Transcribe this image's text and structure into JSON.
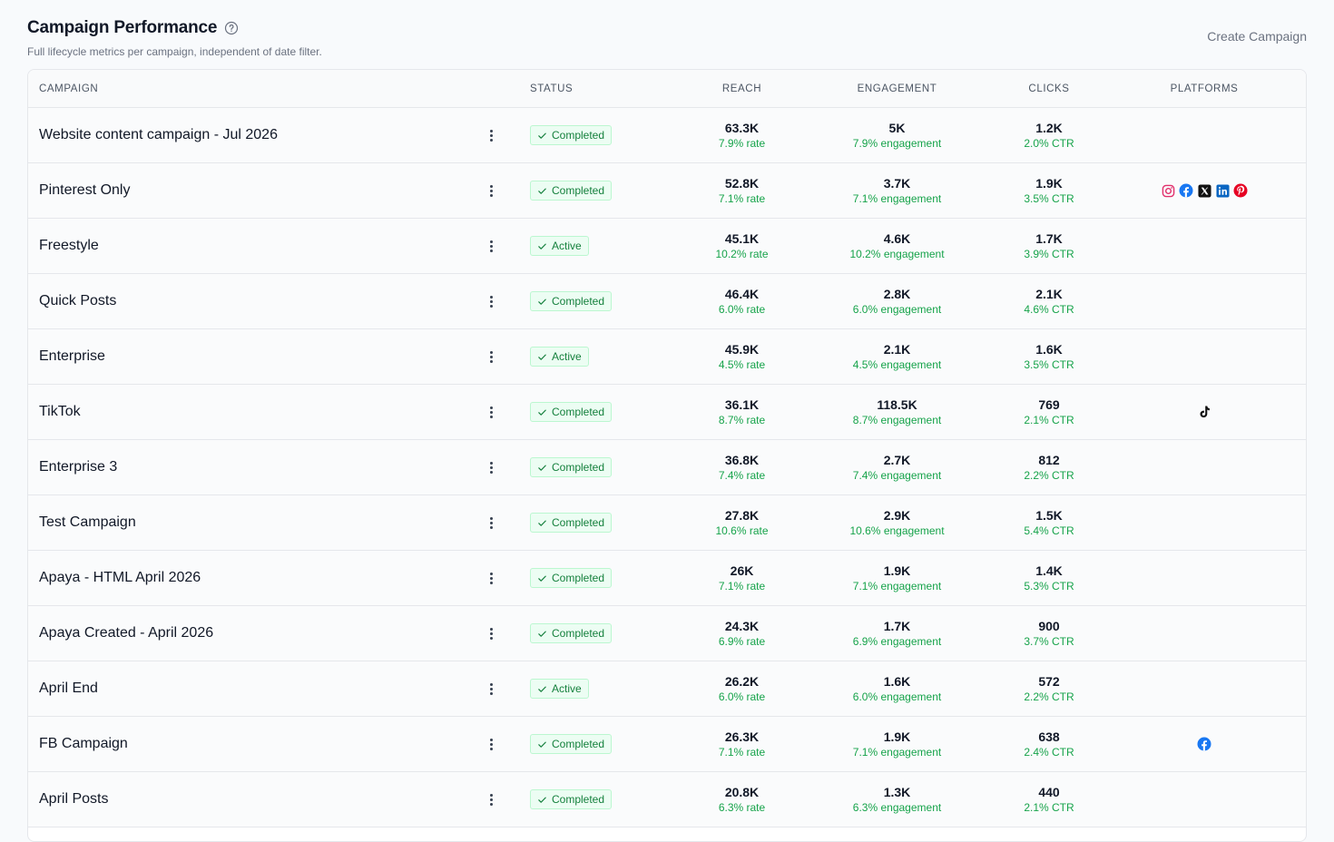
{
  "header": {
    "title": "Campaign Performance",
    "subtitle": "Full lifecycle metrics per campaign, independent of date filter.",
    "create_label": "Create Campaign"
  },
  "columns": {
    "campaign": "CAMPAIGN",
    "status": "STATUS",
    "reach": "REACH",
    "engagement": "ENGAGEMENT",
    "clicks": "CLICKS",
    "platforms": "PLATFORMS"
  },
  "colors": {
    "status_green": "#15803d",
    "badge_bg": "#ecfdf3",
    "metric_green": "#16a34a",
    "instagram": "#e1306c",
    "facebook": "#1877f2",
    "linkedin": "#0a66c2",
    "pinterest": "#e60023"
  },
  "rows": [
    {
      "name": "Website content campaign - Jul 2026",
      "status": "Completed",
      "reach": "63.3K",
      "reach_rate": "7.9% rate",
      "engagement": "5K",
      "engagement_rate": "7.9% engagement",
      "clicks": "1.2K",
      "ctr": "2.0% CTR",
      "platforms": []
    },
    {
      "name": "Pinterest Only",
      "status": "Completed",
      "reach": "52.8K",
      "reach_rate": "7.1% rate",
      "engagement": "3.7K",
      "engagement_rate": "7.1% engagement",
      "clicks": "1.9K",
      "ctr": "3.5% CTR",
      "platforms": [
        "instagram-icon",
        "facebook-icon",
        "x-icon",
        "linkedin-icon",
        "pinterest-icon"
      ]
    },
    {
      "name": "Freestyle",
      "status": "Active",
      "reach": "45.1K",
      "reach_rate": "10.2% rate",
      "engagement": "4.6K",
      "engagement_rate": "10.2% engagement",
      "clicks": "1.7K",
      "ctr": "3.9% CTR",
      "platforms": []
    },
    {
      "name": "Quick Posts",
      "status": "Completed",
      "reach": "46.4K",
      "reach_rate": "6.0% rate",
      "engagement": "2.8K",
      "engagement_rate": "6.0% engagement",
      "clicks": "2.1K",
      "ctr": "4.6% CTR",
      "platforms": []
    },
    {
      "name": "Enterprise",
      "status": "Active",
      "reach": "45.9K",
      "reach_rate": "4.5% rate",
      "engagement": "2.1K",
      "engagement_rate": "4.5% engagement",
      "clicks": "1.6K",
      "ctr": "3.5% CTR",
      "platforms": []
    },
    {
      "name": "TikTok",
      "status": "Completed",
      "reach": "36.1K",
      "reach_rate": "8.7% rate",
      "engagement": "118.5K",
      "engagement_rate": "8.7% engagement",
      "clicks": "769",
      "ctr": "2.1% CTR",
      "platforms": [
        "tiktok-icon"
      ]
    },
    {
      "name": "Enterprise 3",
      "status": "Completed",
      "reach": "36.8K",
      "reach_rate": "7.4% rate",
      "engagement": "2.7K",
      "engagement_rate": "7.4% engagement",
      "clicks": "812",
      "ctr": "2.2% CTR",
      "platforms": []
    },
    {
      "name": "Test Campaign",
      "status": "Completed",
      "reach": "27.8K",
      "reach_rate": "10.6% rate",
      "engagement": "2.9K",
      "engagement_rate": "10.6% engagement",
      "clicks": "1.5K",
      "ctr": "5.4% CTR",
      "platforms": []
    },
    {
      "name": "Apaya - HTML April 2026",
      "status": "Completed",
      "reach": "26K",
      "reach_rate": "7.1% rate",
      "engagement": "1.9K",
      "engagement_rate": "7.1% engagement",
      "clicks": "1.4K",
      "ctr": "5.3% CTR",
      "platforms": []
    },
    {
      "name": "Apaya Created - April 2026",
      "status": "Completed",
      "reach": "24.3K",
      "reach_rate": "6.9% rate",
      "engagement": "1.7K",
      "engagement_rate": "6.9% engagement",
      "clicks": "900",
      "ctr": "3.7% CTR",
      "platforms": []
    },
    {
      "name": "April End",
      "status": "Active",
      "reach": "26.2K",
      "reach_rate": "6.0% rate",
      "engagement": "1.6K",
      "engagement_rate": "6.0% engagement",
      "clicks": "572",
      "ctr": "2.2% CTR",
      "platforms": []
    },
    {
      "name": "FB Campaign",
      "status": "Completed",
      "reach": "26.3K",
      "reach_rate": "7.1% rate",
      "engagement": "1.9K",
      "engagement_rate": "7.1% engagement",
      "clicks": "638",
      "ctr": "2.4% CTR",
      "platforms": [
        "facebook-icon"
      ]
    },
    {
      "name": "April Posts",
      "status": "Completed",
      "reach": "20.8K",
      "reach_rate": "6.3% rate",
      "engagement": "1.3K",
      "engagement_rate": "6.3% engagement",
      "clicks": "440",
      "ctr": "2.1% CTR",
      "platforms": []
    }
  ]
}
